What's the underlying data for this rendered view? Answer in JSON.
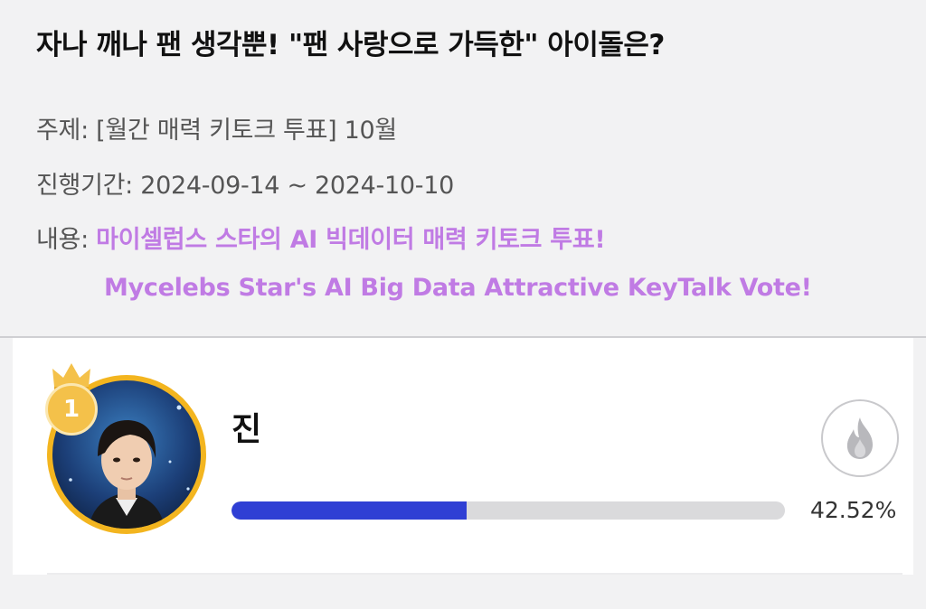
{
  "header": {
    "title": "자나 깨나 팬 생각뿐! \"팬 사랑으로 가득한\" 아이돌은?",
    "topic_label": "주제: ",
    "topic_value": "[월간 매력 키토크 투표] 10월",
    "period_label": "진행기간: ",
    "period_value": "2024-09-14 ~ 2024-10-10",
    "content_label": "내용: ",
    "content_ko": "마이셀럽스 스타의 AI 빅데이터 매력 키토크 투표!",
    "content_en": "Mycelebs Star's AI Big Data Attractive KeyTalk Vote!"
  },
  "ranking": [
    {
      "rank": "1",
      "name": "진",
      "percent_text": "42.52%",
      "percent_value": 42.52,
      "vote_icon": "flame-icon"
    }
  ],
  "colors": {
    "accent": "#c07be4",
    "bar_fill": "#2f3fd4",
    "bar_track": "#dadadc",
    "ring": "#f3b51f"
  }
}
